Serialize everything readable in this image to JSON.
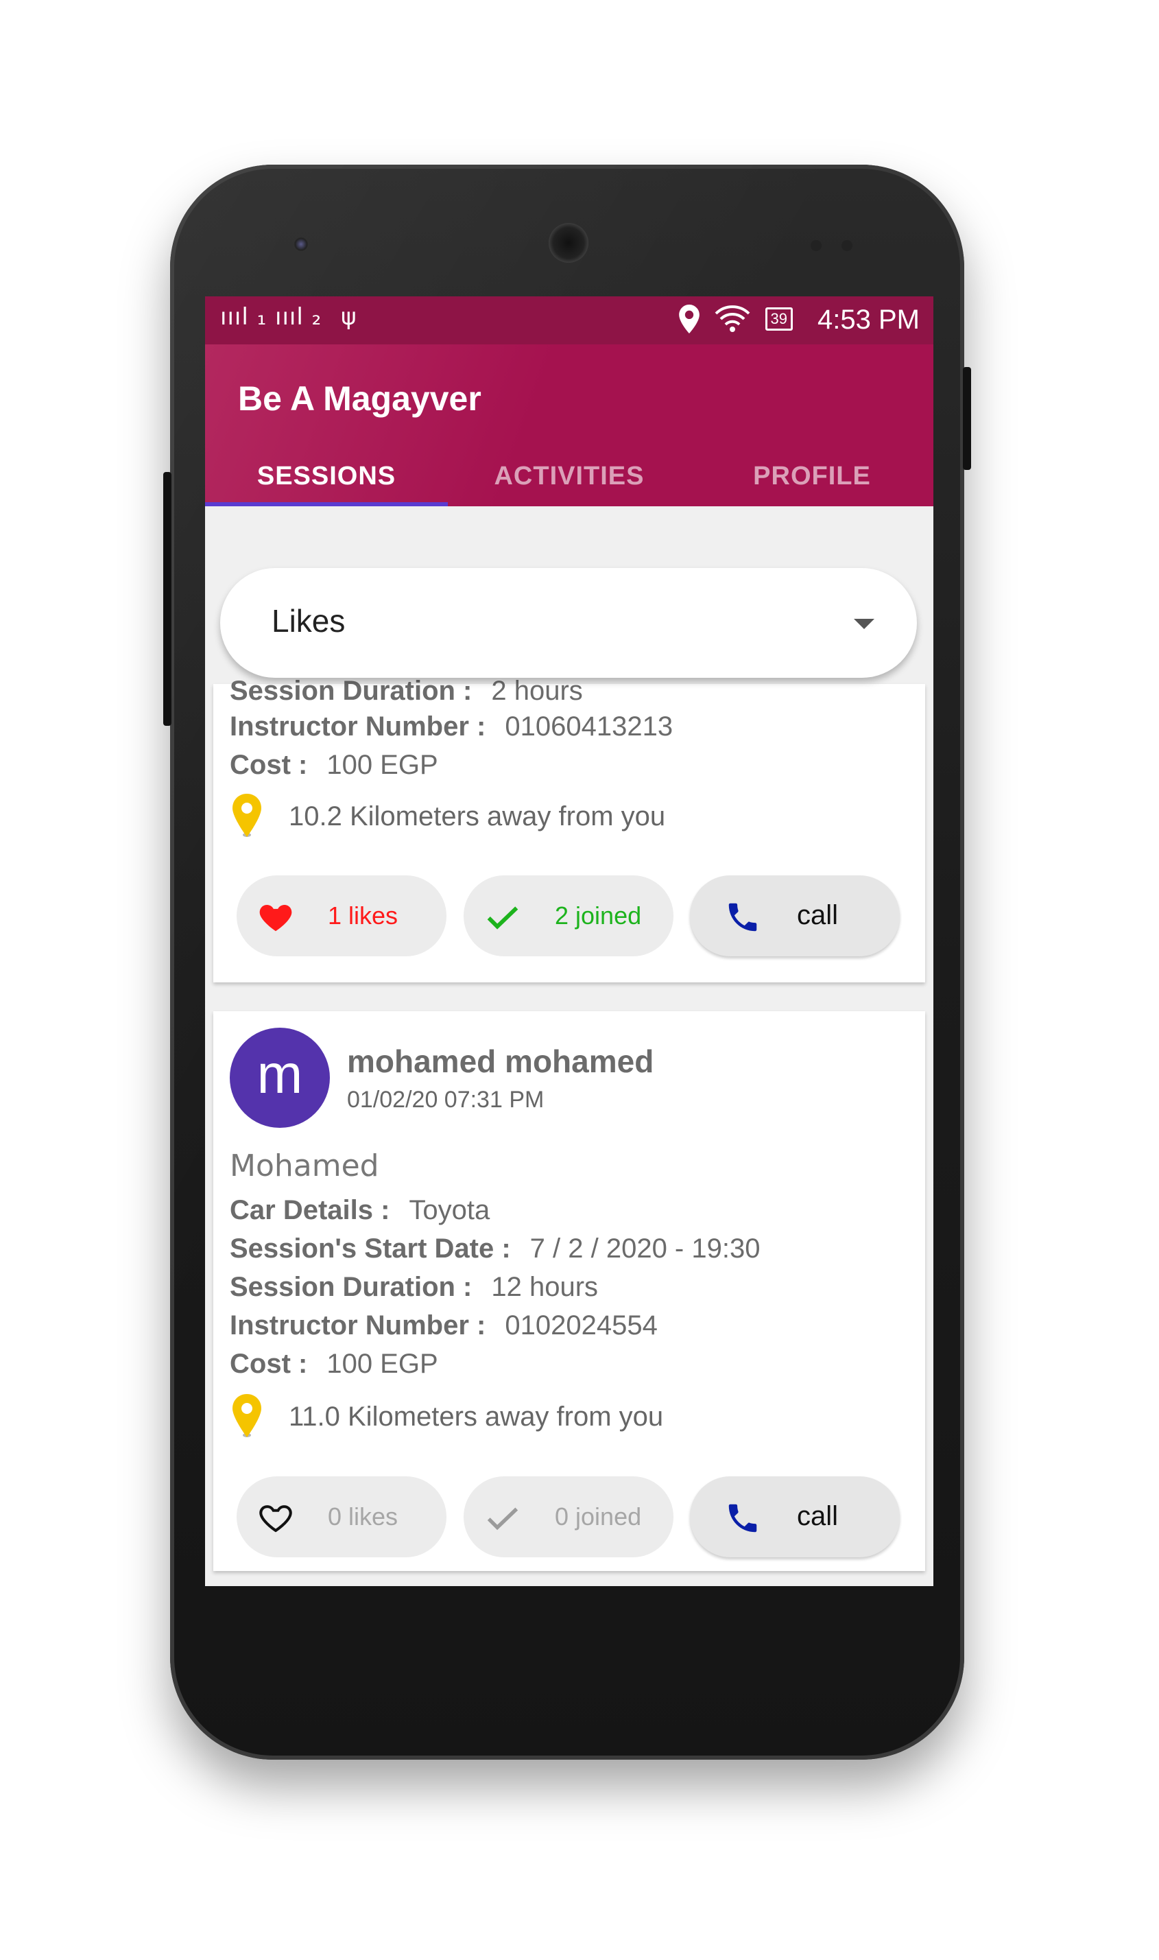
{
  "status_bar": {
    "signal": "ıııl ₁ ıııl ₂",
    "usb": "ψ",
    "battery": "39",
    "time": "4:53 PM"
  },
  "app": {
    "title": "Be A Magayver",
    "tabs": [
      "SESSIONS",
      "ACTIVITIES",
      "PROFILE"
    ],
    "active_tab": "SESSIONS"
  },
  "filter": {
    "selected": "Likes"
  },
  "cards": [
    {
      "fields": [
        {
          "label": "Session Duration :",
          "value": "2 hours"
        },
        {
          "label": "Instructor Number :",
          "value": "01060413213"
        },
        {
          "label": "Cost :",
          "value": "100 EGP"
        }
      ],
      "distance": "10.2 Kilometers away from you",
      "likes": "1 likes",
      "joined": "2 joined",
      "call": "call",
      "liked": true,
      "joined_state": true
    },
    {
      "avatar_letter": "m",
      "user_name": "mohamed mohamed",
      "date": "01/02/20 07:31 PM",
      "title": "Mohamed",
      "fields": [
        {
          "label": "Car Details :",
          "value": "Toyota"
        },
        {
          "label": "Session's Start Date :",
          "value": "7 / 2 / 2020 - 19:30"
        },
        {
          "label": "Session Duration :",
          "value": "12 hours"
        },
        {
          "label": "Instructor Number :",
          "value": "0102024554"
        },
        {
          "label": "Cost :",
          "value": "100 EGP"
        }
      ],
      "distance": "11.0 Kilometers away from you",
      "likes": "0 likes",
      "joined": "0 joined",
      "call": "call",
      "liked": false,
      "joined_state": false
    }
  ],
  "colors": {
    "primary": "#a5124f",
    "status_bar": "#8e1446",
    "tab_indicator": "#5a3bd0",
    "avatar": "#5433ac",
    "like_active": "#ff1a1a",
    "joined_active": "#1db31d",
    "call_icon": "#0a1fa8",
    "pin": "#f5c400"
  }
}
